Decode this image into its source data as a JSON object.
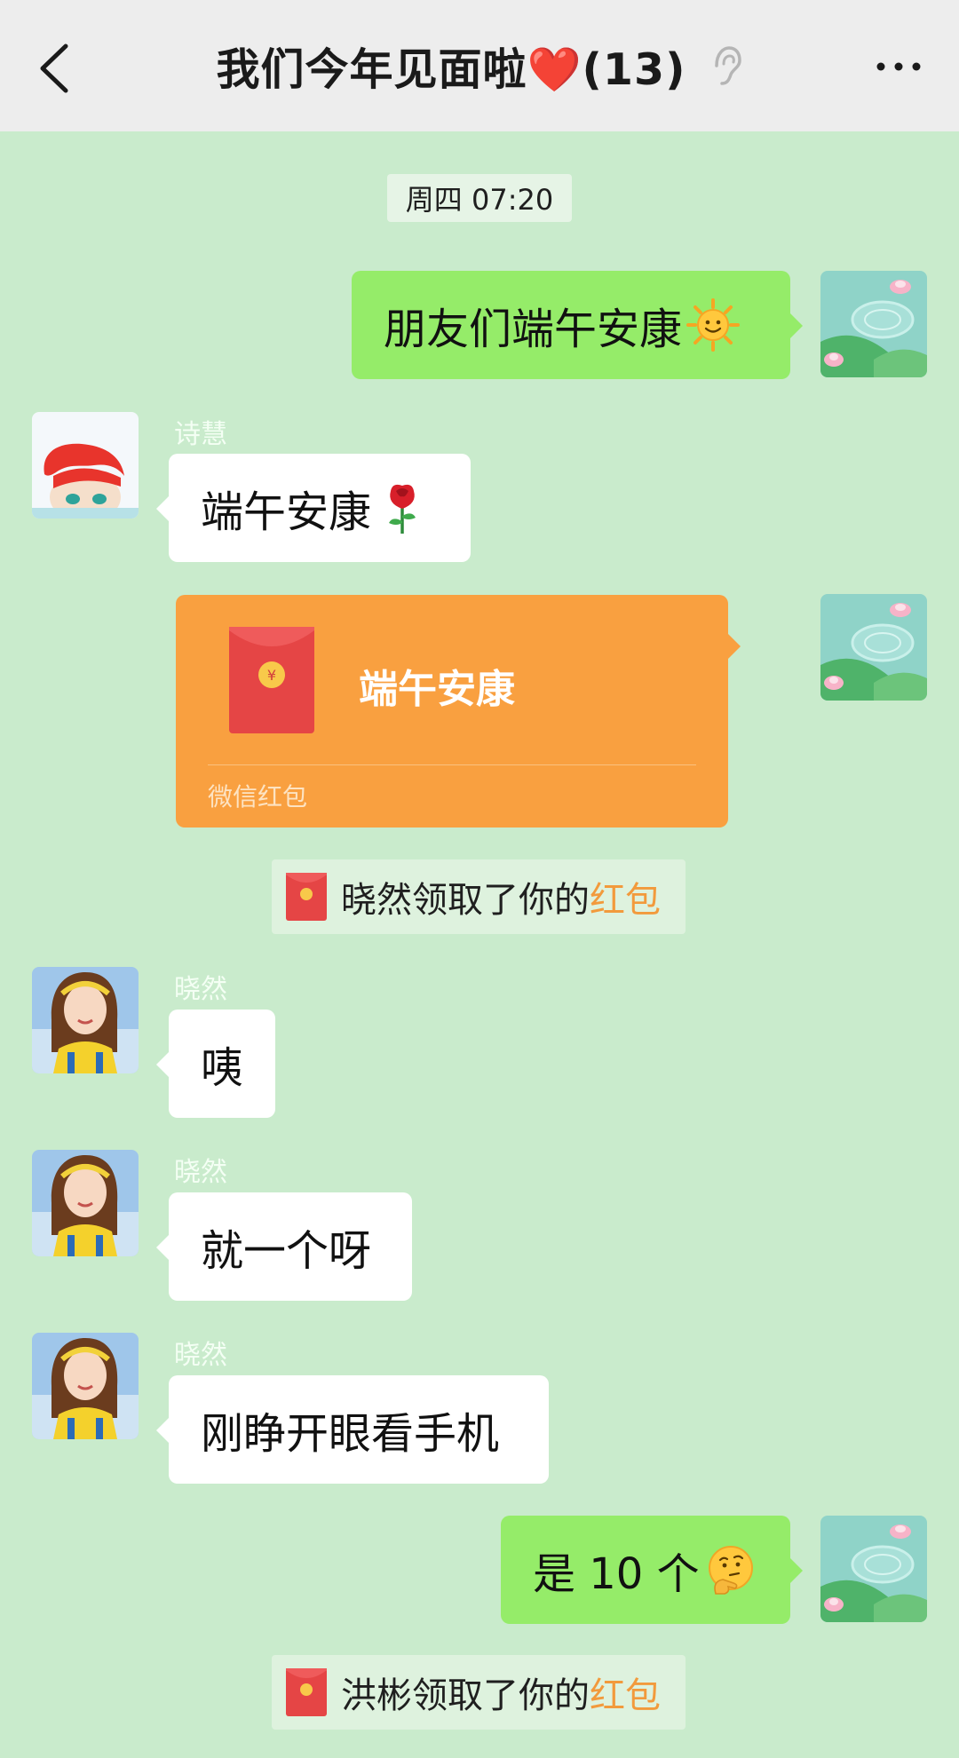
{
  "header": {
    "title": "我们今年见面啦❤️(13)",
    "back_icon": "chevron-left-icon",
    "ear_icon": "ear-icon",
    "more_icon": "more-dots-icon"
  },
  "timestamp": "周四 07:20",
  "messages": [
    {
      "text": "朋友们端午安康",
      "emoji": "sun-face-emoji"
    },
    {
      "sender": "诗慧",
      "text": "端午安康",
      "emoji": "rose-emoji"
    },
    {
      "sender": "晓然",
      "text": "咦"
    },
    {
      "sender": "晓然",
      "text": "就一个呀"
    },
    {
      "sender": "晓然",
      "text": "刚睁开眼看手机"
    },
    {
      "text": "是 10 个",
      "emoji": "thinking-face-emoji"
    }
  ],
  "red_packet": {
    "title": "端午安康",
    "footer": "微信红包"
  },
  "notices": [
    {
      "prefix": "晓然领取了你的",
      "highlight": "红包"
    },
    {
      "prefix": "洪彬领取了你的",
      "highlight": "红包"
    }
  ],
  "colors": {
    "chat_bg": "#c9ebcc",
    "out_bubble": "#95ec69",
    "in_bubble": "#ffffff",
    "red_packet": "#f9a040",
    "highlight": "#f29a3c"
  }
}
